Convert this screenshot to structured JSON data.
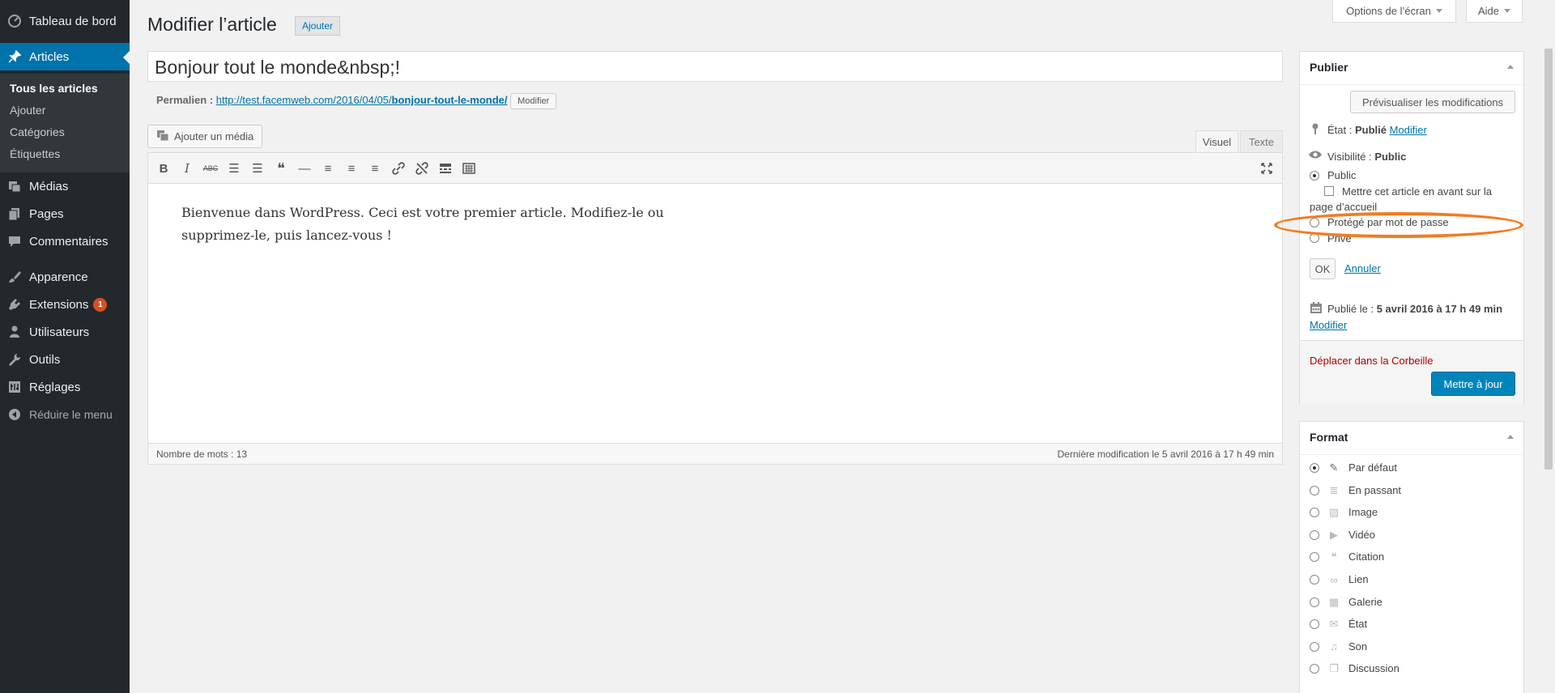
{
  "sidebar": {
    "items": [
      {
        "label": "Tableau de bord",
        "icon": "dashboard-icon"
      },
      {
        "label": "Articles",
        "icon": "pin-icon"
      },
      {
        "label": "Médias",
        "icon": "media-icon"
      },
      {
        "label": "Pages",
        "icon": "pages-icon"
      },
      {
        "label": "Commentaires",
        "icon": "comments-icon"
      },
      {
        "label": "Apparence",
        "icon": "brush-icon"
      },
      {
        "label": "Extensions",
        "icon": "plugin-icon",
        "badge": "1"
      },
      {
        "label": "Utilisateurs",
        "icon": "user-icon"
      },
      {
        "label": "Outils",
        "icon": "wrench-icon"
      },
      {
        "label": "Réglages",
        "icon": "settings-icon"
      }
    ],
    "submenu": [
      "Tous les articles",
      "Ajouter",
      "Catégories",
      "Étiquettes"
    ],
    "collapse_label": "Réduire le menu"
  },
  "header": {
    "title": "Modifier l’article",
    "add_new": "Ajouter",
    "screen_options": "Options de l’écran",
    "help": "Aide"
  },
  "post": {
    "title": "Bonjour tout le monde&nbsp;!",
    "permalink_label": "Permalien :",
    "permalink_base": "http://test.facemweb.com/2016/04/05/",
    "permalink_slug": "bonjour-tout-le-monde/",
    "permalink_edit": "Modifier",
    "content_line1": "Bienvenue dans WordPress. Ceci est votre premier article. Modifiez-le ou",
    "content_line2": "supprimez-le, puis lancez-vous !",
    "word_count": "Nombre de mots : 13",
    "last_modified": "Dernière modification le 5 avril 2016 à 17 h 49 min"
  },
  "editor": {
    "add_media": "Ajouter un média",
    "tab_visual": "Visuel",
    "tab_text": "Texte",
    "toolbar": {
      "bold": "B",
      "italic": "I",
      "strike": "ABC",
      "ul": "☰",
      "ol": "☰",
      "quote": "❝",
      "hr": "—",
      "align_left": "≡",
      "align_center": "≡",
      "align_right": "≡",
      "link": "🔗",
      "unlink": "⛓",
      "more": "▬",
      "kitchen": "▦",
      "fullscreen": "⤢"
    }
  },
  "publish": {
    "title": "Publier",
    "preview": "Prévisualiser les modifications",
    "status_label": "État :",
    "status_value": "Publié",
    "status_edit": "Modifier",
    "visibility_label": "Visibilité :",
    "visibility_value": "Public",
    "opt_public": "Public",
    "sticky": "Mettre cet article en avant sur la",
    "sticky2": "page d’accueil",
    "opt_password": "Protégé par mot de passe",
    "opt_private": "Privé",
    "ok": "OK",
    "cancel": "Annuler",
    "published_label": "Publié le :",
    "published_value": "5 avril 2016 à 17 h 49 min",
    "published_edit": "Modifier",
    "trash": "Déplacer dans la Corbeille",
    "update": "Mettre à jour"
  },
  "format": {
    "title": "Format",
    "options": [
      {
        "label": "Par défaut",
        "icon": "pin-icon",
        "glyph": "✎",
        "checked": true
      },
      {
        "label": "En passant",
        "icon": "aside-icon",
        "glyph": "≣"
      },
      {
        "label": "Image",
        "icon": "image-icon",
        "glyph": "▨"
      },
      {
        "label": "Vidéo",
        "icon": "video-icon",
        "glyph": "▶"
      },
      {
        "label": "Citation",
        "icon": "quote-icon",
        "glyph": "❝"
      },
      {
        "label": "Lien",
        "icon": "link-icon",
        "glyph": "∞"
      },
      {
        "label": "Galerie",
        "icon": "gallery-icon",
        "glyph": "▦"
      },
      {
        "label": "État",
        "icon": "status-icon",
        "glyph": "✉"
      },
      {
        "label": "Son",
        "icon": "audio-icon",
        "glyph": "♫"
      },
      {
        "label": "Discussion",
        "icon": "chat-icon",
        "glyph": "❐"
      }
    ]
  }
}
